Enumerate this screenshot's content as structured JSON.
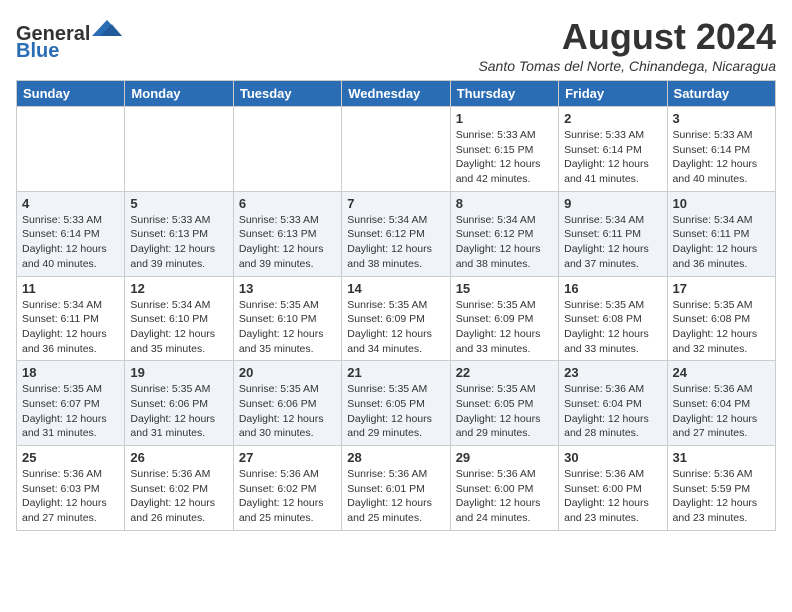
{
  "logo": {
    "general": "General",
    "blue": "Blue"
  },
  "header": {
    "month_year": "August 2024",
    "location": "Santo Tomas del Norte, Chinandega, Nicaragua"
  },
  "weekdays": [
    "Sunday",
    "Monday",
    "Tuesday",
    "Wednesday",
    "Thursday",
    "Friday",
    "Saturday"
  ],
  "weeks": [
    [
      {
        "day": "",
        "info": ""
      },
      {
        "day": "",
        "info": ""
      },
      {
        "day": "",
        "info": ""
      },
      {
        "day": "",
        "info": ""
      },
      {
        "day": "1",
        "info": "Sunrise: 5:33 AM\nSunset: 6:15 PM\nDaylight: 12 hours\nand 42 minutes."
      },
      {
        "day": "2",
        "info": "Sunrise: 5:33 AM\nSunset: 6:14 PM\nDaylight: 12 hours\nand 41 minutes."
      },
      {
        "day": "3",
        "info": "Sunrise: 5:33 AM\nSunset: 6:14 PM\nDaylight: 12 hours\nand 40 minutes."
      }
    ],
    [
      {
        "day": "4",
        "info": "Sunrise: 5:33 AM\nSunset: 6:14 PM\nDaylight: 12 hours\nand 40 minutes."
      },
      {
        "day": "5",
        "info": "Sunrise: 5:33 AM\nSunset: 6:13 PM\nDaylight: 12 hours\nand 39 minutes."
      },
      {
        "day": "6",
        "info": "Sunrise: 5:33 AM\nSunset: 6:13 PM\nDaylight: 12 hours\nand 39 minutes."
      },
      {
        "day": "7",
        "info": "Sunrise: 5:34 AM\nSunset: 6:12 PM\nDaylight: 12 hours\nand 38 minutes."
      },
      {
        "day": "8",
        "info": "Sunrise: 5:34 AM\nSunset: 6:12 PM\nDaylight: 12 hours\nand 38 minutes."
      },
      {
        "day": "9",
        "info": "Sunrise: 5:34 AM\nSunset: 6:11 PM\nDaylight: 12 hours\nand 37 minutes."
      },
      {
        "day": "10",
        "info": "Sunrise: 5:34 AM\nSunset: 6:11 PM\nDaylight: 12 hours\nand 36 minutes."
      }
    ],
    [
      {
        "day": "11",
        "info": "Sunrise: 5:34 AM\nSunset: 6:11 PM\nDaylight: 12 hours\nand 36 minutes."
      },
      {
        "day": "12",
        "info": "Sunrise: 5:34 AM\nSunset: 6:10 PM\nDaylight: 12 hours\nand 35 minutes."
      },
      {
        "day": "13",
        "info": "Sunrise: 5:35 AM\nSunset: 6:10 PM\nDaylight: 12 hours\nand 35 minutes."
      },
      {
        "day": "14",
        "info": "Sunrise: 5:35 AM\nSunset: 6:09 PM\nDaylight: 12 hours\nand 34 minutes."
      },
      {
        "day": "15",
        "info": "Sunrise: 5:35 AM\nSunset: 6:09 PM\nDaylight: 12 hours\nand 33 minutes."
      },
      {
        "day": "16",
        "info": "Sunrise: 5:35 AM\nSunset: 6:08 PM\nDaylight: 12 hours\nand 33 minutes."
      },
      {
        "day": "17",
        "info": "Sunrise: 5:35 AM\nSunset: 6:08 PM\nDaylight: 12 hours\nand 32 minutes."
      }
    ],
    [
      {
        "day": "18",
        "info": "Sunrise: 5:35 AM\nSunset: 6:07 PM\nDaylight: 12 hours\nand 31 minutes."
      },
      {
        "day": "19",
        "info": "Sunrise: 5:35 AM\nSunset: 6:06 PM\nDaylight: 12 hours\nand 31 minutes."
      },
      {
        "day": "20",
        "info": "Sunrise: 5:35 AM\nSunset: 6:06 PM\nDaylight: 12 hours\nand 30 minutes."
      },
      {
        "day": "21",
        "info": "Sunrise: 5:35 AM\nSunset: 6:05 PM\nDaylight: 12 hours\nand 29 minutes."
      },
      {
        "day": "22",
        "info": "Sunrise: 5:35 AM\nSunset: 6:05 PM\nDaylight: 12 hours\nand 29 minutes."
      },
      {
        "day": "23",
        "info": "Sunrise: 5:36 AM\nSunset: 6:04 PM\nDaylight: 12 hours\nand 28 minutes."
      },
      {
        "day": "24",
        "info": "Sunrise: 5:36 AM\nSunset: 6:04 PM\nDaylight: 12 hours\nand 27 minutes."
      }
    ],
    [
      {
        "day": "25",
        "info": "Sunrise: 5:36 AM\nSunset: 6:03 PM\nDaylight: 12 hours\nand 27 minutes."
      },
      {
        "day": "26",
        "info": "Sunrise: 5:36 AM\nSunset: 6:02 PM\nDaylight: 12 hours\nand 26 minutes."
      },
      {
        "day": "27",
        "info": "Sunrise: 5:36 AM\nSunset: 6:02 PM\nDaylight: 12 hours\nand 25 minutes."
      },
      {
        "day": "28",
        "info": "Sunrise: 5:36 AM\nSunset: 6:01 PM\nDaylight: 12 hours\nand 25 minutes."
      },
      {
        "day": "29",
        "info": "Sunrise: 5:36 AM\nSunset: 6:00 PM\nDaylight: 12 hours\nand 24 minutes."
      },
      {
        "day": "30",
        "info": "Sunrise: 5:36 AM\nSunset: 6:00 PM\nDaylight: 12 hours\nand 23 minutes."
      },
      {
        "day": "31",
        "info": "Sunrise: 5:36 AM\nSunset: 5:59 PM\nDaylight: 12 hours\nand 23 minutes."
      }
    ]
  ]
}
